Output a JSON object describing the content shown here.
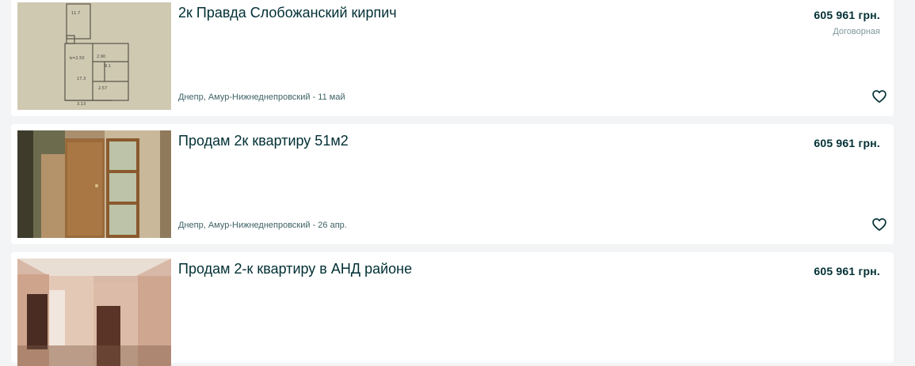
{
  "listings": [
    {
      "title": "2к Правда Слобожанский кирпич",
      "price": "605 961 грн.",
      "negotiable": "Договорная",
      "location_date": "Днепр, Амур-Нижнеднепровский - 11 май",
      "image": "floor-plan-photo"
    },
    {
      "title": "Продам 2к квартиру 51м2",
      "price": "605 961 грн.",
      "location_date": "Днепр, Амур-Нижнеднепровский - 26 апр.",
      "image": "hallway-door-photo"
    },
    {
      "title": "Продам 2-к квартиру в АНД районе",
      "price": "605 961 грн.",
      "image": "room-interior-photo"
    }
  ],
  "icons": {
    "favorite": "heart-outline-icon"
  },
  "colors": {
    "title": "#002f34",
    "meta": "#406367",
    "background": "#f2f4f5"
  }
}
